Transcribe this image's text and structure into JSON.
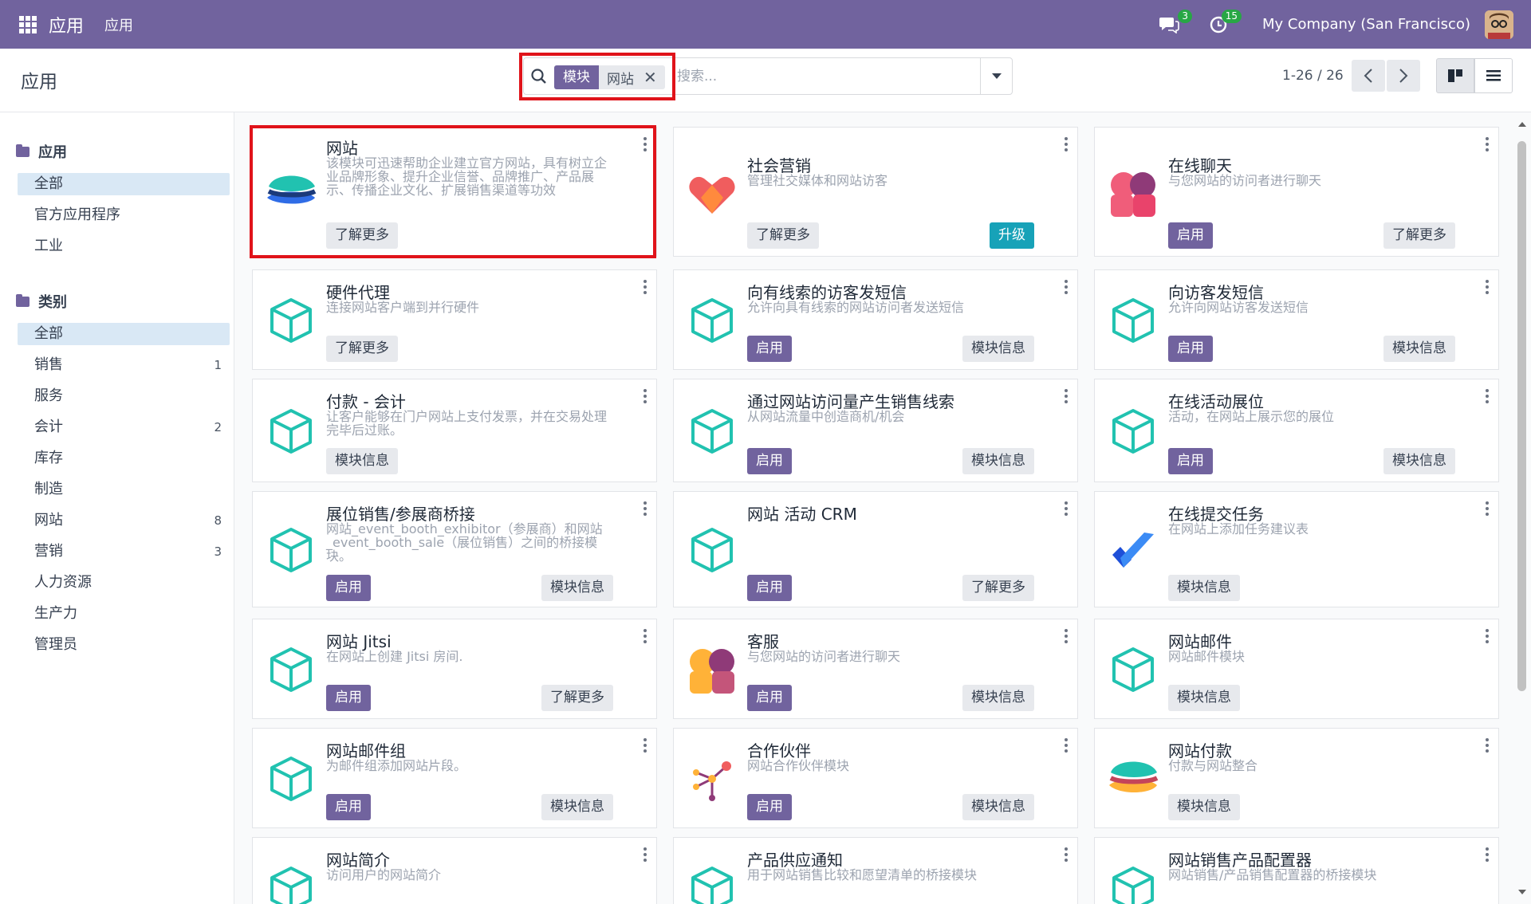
{
  "navbar": {
    "brand": "应用",
    "menu": "应用",
    "chat_count": "3",
    "activity_count": "15",
    "company": "My Company (San Francisco)"
  },
  "control": {
    "title": "应用",
    "facet_key": "模块",
    "facet_value": "网站",
    "search_placeholder": "搜索...",
    "pager": "1-26 / 26"
  },
  "sidebar": {
    "apps_heading": "应用",
    "apps_items": [
      "全部",
      "官方应用程序",
      "工业"
    ],
    "categories_heading": "类别",
    "categories": [
      {
        "label": "全部",
        "count": ""
      },
      {
        "label": "销售",
        "count": "1"
      },
      {
        "label": "服务",
        "count": ""
      },
      {
        "label": "会计",
        "count": "2"
      },
      {
        "label": "库存",
        "count": ""
      },
      {
        "label": "制造",
        "count": ""
      },
      {
        "label": "网站",
        "count": "8"
      },
      {
        "label": "营销",
        "count": "3"
      },
      {
        "label": "人力资源",
        "count": ""
      },
      {
        "label": "生产力",
        "count": ""
      },
      {
        "label": "管理员",
        "count": ""
      }
    ]
  },
  "cards": [
    {
      "title": "网站",
      "desc": "该模块可迅速帮助企业建立官方网站，具有树立企业品牌形象、提升企业信誉、品牌推广、产品展示、传播企业文化、扩展销售渠道等功效",
      "icon": "website-icon",
      "btn1": "了解更多",
      "btn1_style": "light",
      "btn2": ""
    },
    {
      "title": "社会营销",
      "desc": "管理社交媒体和网站访客",
      "icon": "social-heart-icon",
      "btn1": "了解更多",
      "btn1_style": "light",
      "btn2": "升级",
      "btn2_style": "info"
    },
    {
      "title": "在线聊天",
      "desc": "与您网站的访问者进行聊天",
      "icon": "live-chat-icon",
      "btn1": "启用",
      "btn1_style": "primary",
      "btn2": "了解更多",
      "btn2_style": "light"
    },
    {
      "title": "硬件代理",
      "desc": "连接网站客户端到并行硬件",
      "icon": "module-cube-icon",
      "btn1": "了解更多",
      "btn1_style": "light",
      "btn2": ""
    },
    {
      "title": "向有线索的访客发短信",
      "desc": "允许向具有线索的网站访问者发送短信",
      "icon": "module-cube-icon",
      "btn1": "启用",
      "btn1_style": "primary",
      "btn2": "模块信息",
      "btn2_style": "light"
    },
    {
      "title": "向访客发短信",
      "desc": "允许向网站访客发送短信",
      "icon": "module-cube-icon",
      "btn1": "启用",
      "btn1_style": "primary",
      "btn2": "模块信息",
      "btn2_style": "light"
    },
    {
      "title": "付款 - 会计",
      "desc": "让客户能够在门户网站上支付发票，并在交易处理完毕后过账。",
      "icon": "module-cube-icon",
      "btn1": "模块信息",
      "btn1_style": "light",
      "btn2": ""
    },
    {
      "title": "通过网站访问量产生销售线索",
      "desc": "从网站流量中创造商机/机会",
      "icon": "module-cube-icon",
      "btn1": "启用",
      "btn1_style": "primary",
      "btn2": "模块信息",
      "btn2_style": "light"
    },
    {
      "title": "在线活动展位",
      "desc": "活动，在网站上展示您的展位",
      "icon": "module-cube-icon",
      "btn1": "启用",
      "btn1_style": "primary",
      "btn2": "模块信息",
      "btn2_style": "light"
    },
    {
      "title": "展位销售/参展商桥接",
      "desc": "网站_event_booth_exhibitor（参展商）和网站_event_booth_sale（展位销售）之间的桥接模块。",
      "icon": "module-cube-icon",
      "btn1": "启用",
      "btn1_style": "primary",
      "btn2": "模块信息",
      "btn2_style": "light"
    },
    {
      "title": "网站 活动 CRM",
      "desc": "",
      "icon": "module-cube-icon",
      "btn1": "启用",
      "btn1_style": "primary",
      "btn2": "了解更多",
      "btn2_style": "light"
    },
    {
      "title": "在线提交任务",
      "desc": "在网站上添加任务建议表",
      "icon": "task-check-icon",
      "btn1": "模块信息",
      "btn1_style": "light",
      "btn2": ""
    },
    {
      "title": "网站 Jitsi",
      "desc": "在网站上创建 Jitsi 房间.",
      "icon": "module-cube-icon",
      "btn1": "启用",
      "btn1_style": "primary",
      "btn2": "了解更多",
      "btn2_style": "light"
    },
    {
      "title": "客服",
      "desc": "与您网站的访问者进行聊天",
      "icon": "helpdesk-icon",
      "btn1": "启用",
      "btn1_style": "primary",
      "btn2": "模块信息",
      "btn2_style": "light"
    },
    {
      "title": "网站邮件",
      "desc": "网站邮件模块",
      "icon": "module-cube-icon",
      "btn1": "模块信息",
      "btn1_style": "light",
      "btn2": ""
    },
    {
      "title": "网站邮件组",
      "desc": "为邮件组添加网站片段。",
      "icon": "module-cube-icon",
      "btn1": "启用",
      "btn1_style": "primary",
      "btn2": "模块信息",
      "btn2_style": "light"
    },
    {
      "title": "合作伙伴",
      "desc": "网站合作伙伴模块",
      "icon": "partner-network-icon",
      "btn1": "启用",
      "btn1_style": "primary",
      "btn2": "模块信息",
      "btn2_style": "light"
    },
    {
      "title": "网站付款",
      "desc": "付款与网站整合",
      "icon": "website-payment-icon",
      "btn1": "模块信息",
      "btn1_style": "light",
      "btn2": ""
    },
    {
      "title": "网站简介",
      "desc": "访问用户的网站简介",
      "icon": "module-cube-icon",
      "btn1": "",
      "btn2": ""
    },
    {
      "title": "产品供应通知",
      "desc": "用于网站销售比较和愿望清单的桥接模块",
      "icon": "module-cube-icon",
      "btn1": "",
      "btn2": ""
    },
    {
      "title": "网站销售产品配置器",
      "desc": "网站销售/产品销售配置器的桥接模块",
      "icon": "module-cube-icon",
      "btn1": "",
      "btn2": ""
    }
  ]
}
